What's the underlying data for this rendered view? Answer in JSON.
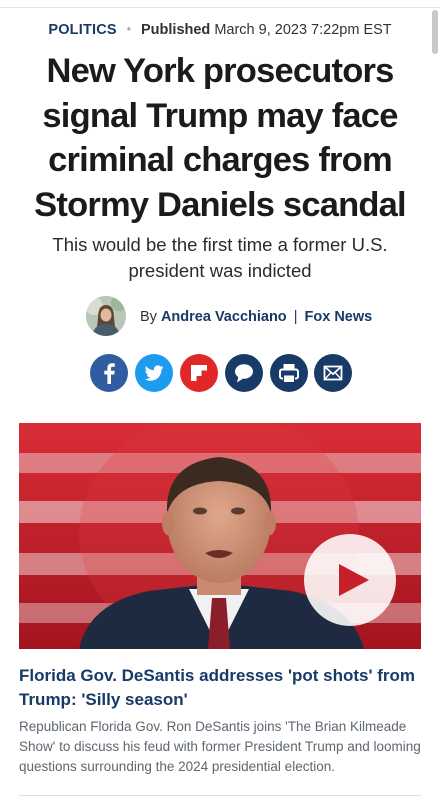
{
  "article": {
    "section": "POLITICS",
    "published_label": "Published",
    "published_date": "March 9, 2023 7:22pm EST",
    "headline": "New York prosecutors signal Trump may face criminal charges from Stormy Daniels scandal",
    "subheadline": "This would be the first time a former U.S. president was indicted",
    "byline": {
      "prefix": "By",
      "author": "Andrea Vacchiano",
      "separator": "|",
      "outlet": "Fox News"
    }
  },
  "share": [
    {
      "name": "facebook",
      "icon": "facebook-icon",
      "color": "#2f5d9f"
    },
    {
      "name": "twitter",
      "icon": "twitter-bird-icon",
      "color": "#1d9bf0"
    },
    {
      "name": "flipboard",
      "icon": "flipboard-icon",
      "color": "#e12828"
    },
    {
      "name": "comments",
      "icon": "speech-bubble-icon",
      "color": "#183a67"
    },
    {
      "name": "print",
      "icon": "printer-icon",
      "color": "#183a67"
    },
    {
      "name": "email",
      "icon": "envelope-icon",
      "color": "#183a67"
    }
  ],
  "video": {
    "play_icon": "play-icon",
    "play_color": "#c8202b",
    "title": "Florida Gov. DeSantis addresses 'pot shots' from Trump: 'Silly season'",
    "description": "Republican Florida Gov. Ron DeSantis joins 'The Brian Kilmeade Show' to discuss his feud with former President Trump and looming questions surrounding the 2024 presidential election."
  }
}
